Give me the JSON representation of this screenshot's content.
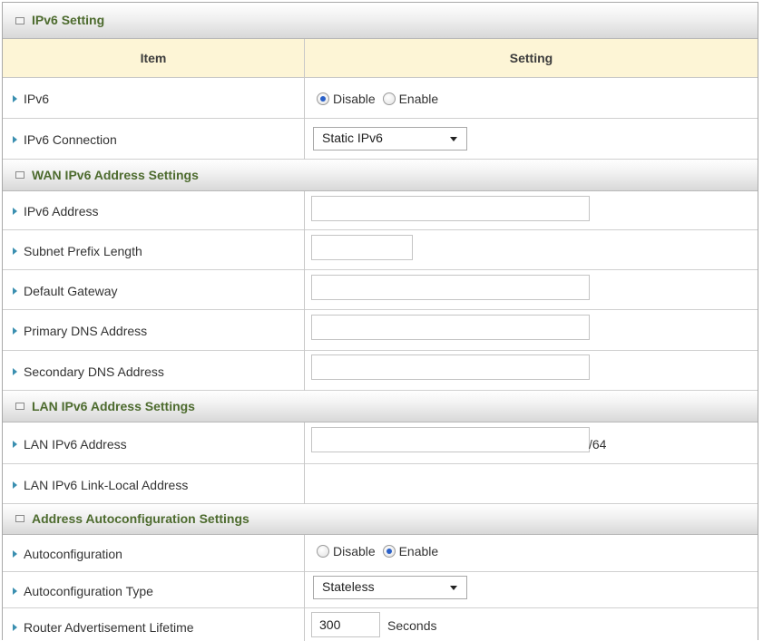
{
  "sections": {
    "ipv6_setting": "IPv6 Setting",
    "wan": "WAN IPv6 Address Settings",
    "lan": "LAN IPv6 Address Settings",
    "autoconf": "Address Autoconfiguration Settings"
  },
  "table_header": {
    "item": "Item",
    "setting": "Setting"
  },
  "rows": {
    "ipv6": {
      "label": "IPv6",
      "options": [
        "Disable",
        "Enable"
      ],
      "selected": "Disable"
    },
    "ipv6_connection": {
      "label": "IPv6 Connection",
      "value": "Static IPv6"
    },
    "ipv6_address": {
      "label": "IPv6 Address",
      "value": ""
    },
    "subnet_prefix_length": {
      "label": "Subnet Prefix Length",
      "value": ""
    },
    "default_gateway": {
      "label": "Default Gateway",
      "value": ""
    },
    "primary_dns": {
      "label": "Primary DNS Address",
      "value": ""
    },
    "secondary_dns": {
      "label": "Secondary DNS Address",
      "value": ""
    },
    "lan_ipv6_address": {
      "label": "LAN IPv6 Address",
      "value": "",
      "suffix": "/64"
    },
    "lan_link_local": {
      "label": "LAN IPv6 Link-Local Address",
      "value": ""
    },
    "autoconfiguration": {
      "label": "Autoconfiguration",
      "options": [
        "Disable",
        "Enable"
      ],
      "selected": "Enable"
    },
    "autoconfiguration_type": {
      "label": "Autoconfiguration Type",
      "value": "Stateless"
    },
    "ra_lifetime": {
      "label": "Router Advertisement Lifetime",
      "value": "300",
      "unit": "Seconds"
    }
  },
  "icons": {
    "bullet": "triangle-right-icon",
    "section": "square-icon"
  },
  "colors": {
    "section_title": "#4d6b2e",
    "header_bg": "#fdf5d6",
    "bullet": "#3a8fb0",
    "radio_selected": "#2a60c8"
  }
}
